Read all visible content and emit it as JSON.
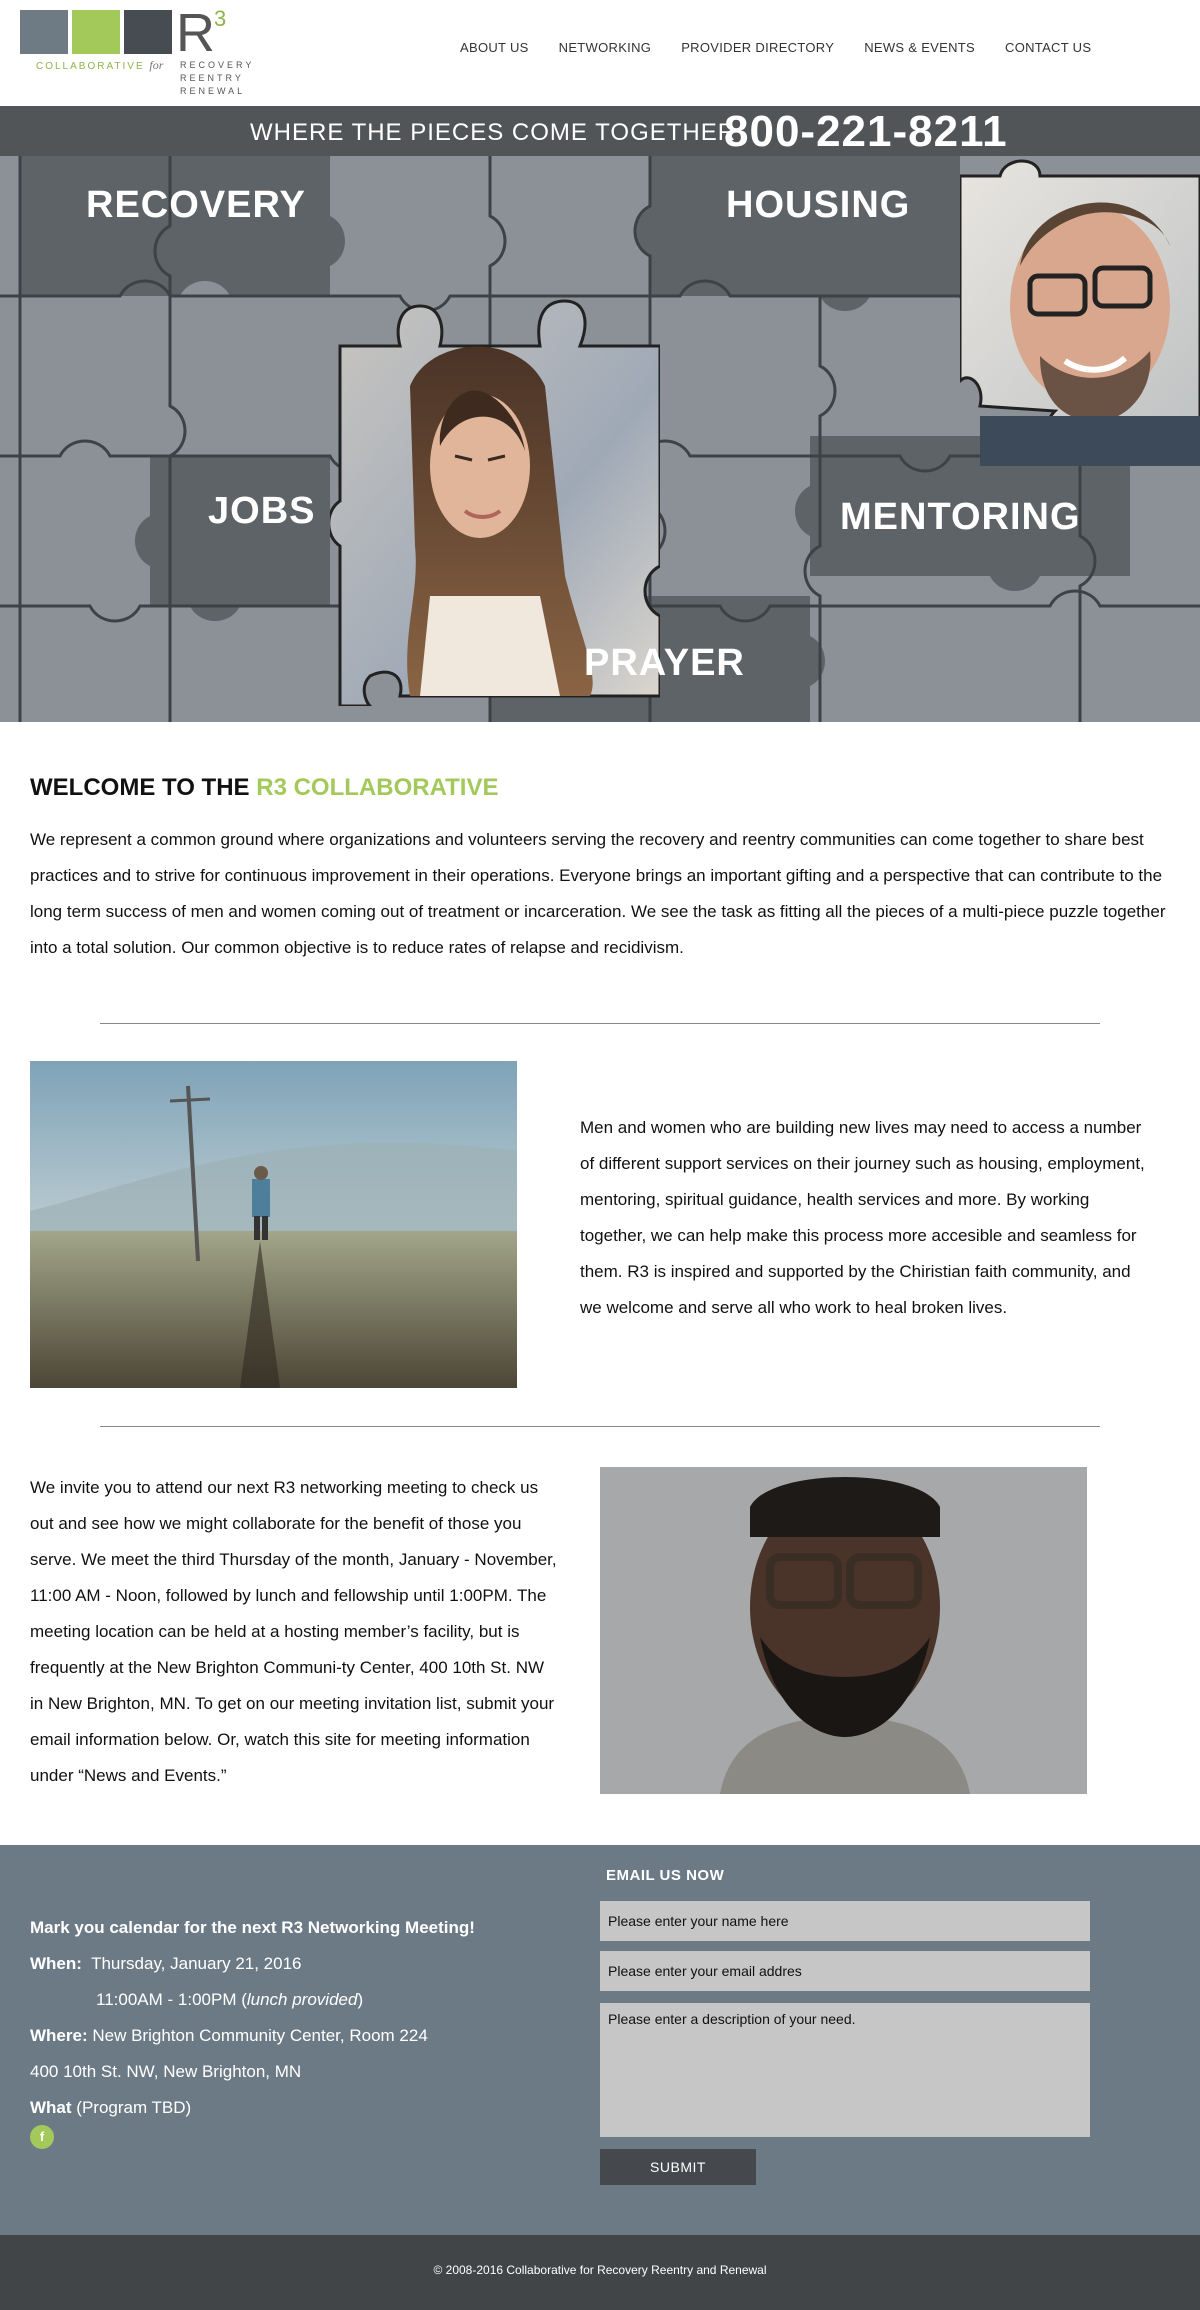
{
  "logo": {
    "mark": "R",
    "mark_sup": "3",
    "tagline_main": "COLLABORATIVE",
    "tagline_for": "for",
    "line1": "RECOVERY",
    "line2": "REENTRY",
    "line3": "RENEWAL"
  },
  "nav": {
    "items": [
      {
        "label": "ABOUT US"
      },
      {
        "label": "NETWORKING"
      },
      {
        "label": "PROVIDER DIRECTORY"
      },
      {
        "label": "NEWS & EVENTS"
      },
      {
        "label": "CONTACT US"
      }
    ]
  },
  "hero": {
    "tagline": "WHERE THE PIECES COME TOGETHER",
    "phone": "800-221-8211",
    "words": {
      "recovery": "RECOVERY",
      "housing": "HOUSING",
      "jobs": "JOBS",
      "mentoring": "MENTORING",
      "prayer": "PRAYER"
    }
  },
  "welcome": {
    "title_prefix": "WELCOME TO THE",
    "title_accent": "R3 COLLABORATIVE",
    "body": "We represent a common ground where organizations and volunteers serving the recovery and reentry communities can come together to share best practices and to strive for continuous improvement in their operations.  Everyone brings an important gifting and a perspective that can contribute to the long term success of men and women coming out of treatment or incarceration.  We see the task as fitting all the pieces of a multi-piece puzzle together into a total solution.  Our common objective is to reduce rates of relapse and recidivism."
  },
  "support": {
    "body": "Men and women who are building new lives may need to access a number of different support services on their journey such as housing, employment, mentoring, spiritual guidance, health services and more.  By working together, we can help make this process more accesible and seamless for them.  R3 is inspired and supported by the Chiristian faith community, and we welcome and serve all who work to heal broken lives."
  },
  "invite": {
    "body": "We invite you to attend our next R3 networking meeting to check us out and see how we might collaborate for the benefit of those you serve.  We meet the third Thursday of the month, January - November, 11:00 AM - Noon, followed by lunch and fellowship until 1:00PM.  The meeting location can be held at a hosting member’s facility, but is frequently at the New Brighton Communi-ty Center, 400 10th St. NW in New Brighton, MN.  To get on our meeting invitation list, submit your email information  below.  Or, watch this site for meeting information under “News and Events.”"
  },
  "meeting": {
    "headline": "Mark you calendar for the next R3 Networking Meeting!",
    "when_label": "When:",
    "when_date": "Thursday, January 21, 2016",
    "when_time": "11:00AM - 1:00PM (",
    "when_note": "lunch provided",
    "when_close": ")",
    "where_label": "Where:",
    "where_place": "New Brighton Community Center, Room 224",
    "where_address": "400 10th St. NW, New Brighton, MN",
    "what_label": "What",
    "what_value": "(Program TBD)",
    "facebook": "f"
  },
  "email_form": {
    "title": "EMAIL US NOW",
    "name_placeholder": "Please enter your name here",
    "email_placeholder": "Please enter your email addres",
    "desc_placeholder": "Please enter a description of your need.",
    "submit_label": "SUBMIT"
  },
  "footer": {
    "copyright": "© 2008-2016 Collaborative for Recovery Reentry and Renewal"
  },
  "colors": {
    "accent_green": "#a3c95a",
    "slate": "#6c7a85",
    "dark": "#414548"
  }
}
